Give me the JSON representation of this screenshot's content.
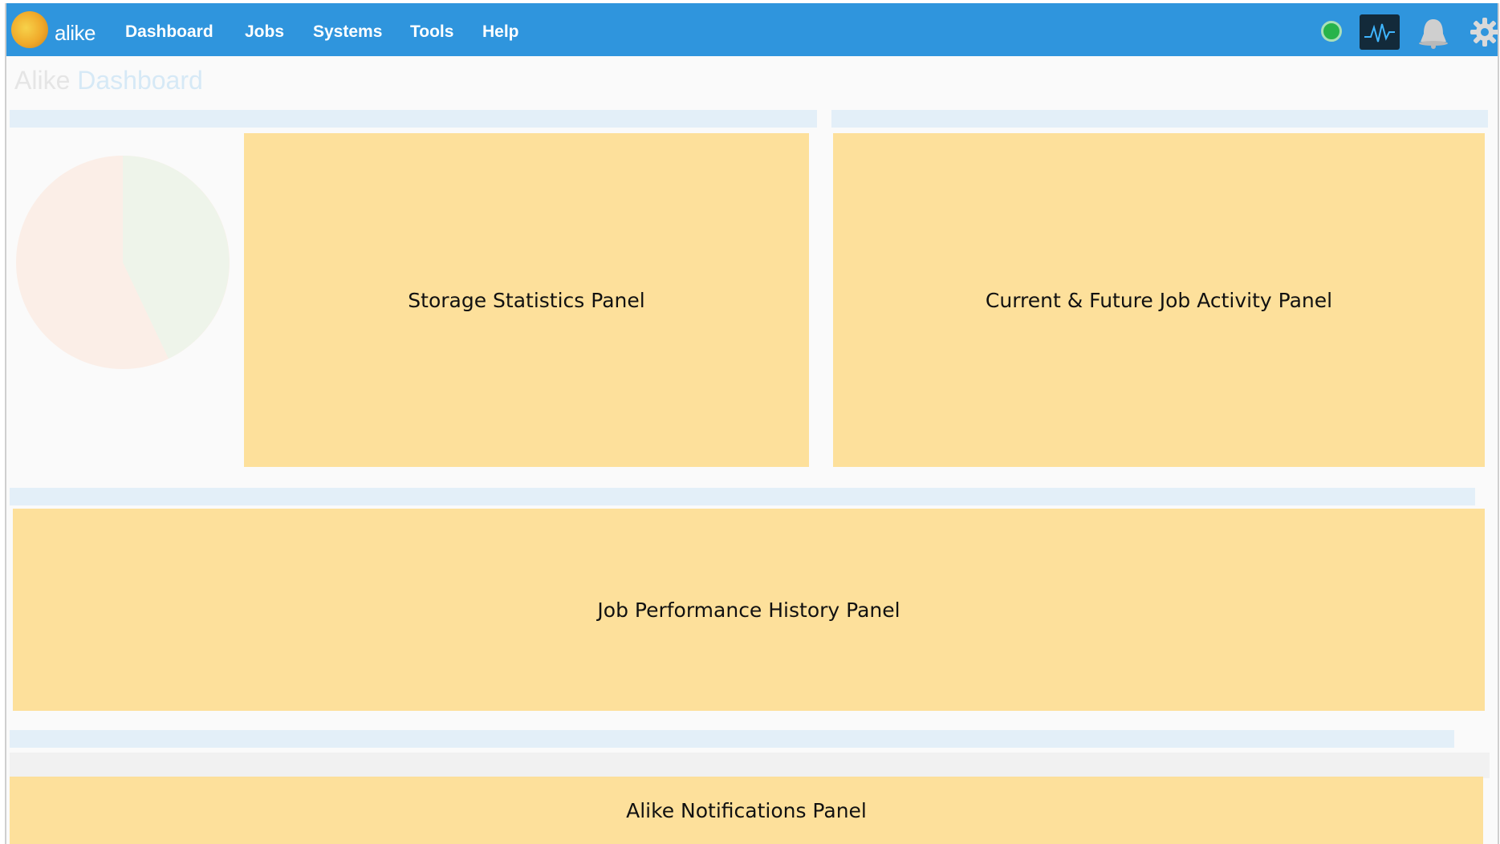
{
  "app": {
    "logo_text": "alike",
    "page_title": "Alike",
    "page_title_accent": "Dashboard"
  },
  "nav": {
    "items": [
      {
        "label": "Dashboard"
      },
      {
        "label": "Jobs"
      },
      {
        "label": "Systems"
      },
      {
        "label": "Tools"
      },
      {
        "label": "Help"
      }
    ],
    "status_left": "",
    "status_right": ""
  },
  "icons": {
    "status": "status-online-icon",
    "monitor": "activity-monitor-icon",
    "notifications": "bell-icon",
    "settings": "gear-icon"
  },
  "panels": {
    "storage": {
      "label": "Storage Statistics Panel"
    },
    "job_activity": {
      "label": "Current & Future Job Activity Panel"
    },
    "performance": {
      "label": "Job Performance History Panel"
    },
    "notifications": {
      "label": "Alike Notifications Panel"
    }
  },
  "colors": {
    "nav_bar": "#2f95dd",
    "panel_overlay": "#fdde93",
    "status_online": "#27b34a"
  }
}
